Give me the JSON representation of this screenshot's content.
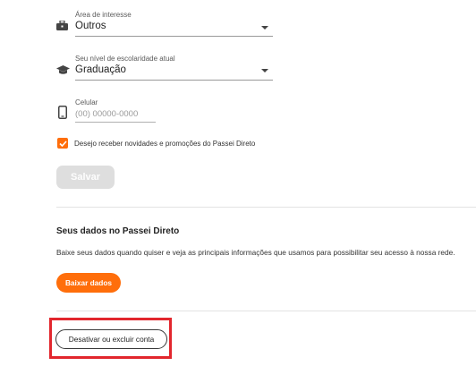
{
  "area": {
    "label": "Área de interesse",
    "value": "Outros"
  },
  "escolaridade": {
    "label": "Seu nível de escolaridade atual",
    "value": "Graduação"
  },
  "celular": {
    "label": "Celular",
    "placeholder": "(00) 00000-0000"
  },
  "newsletter": {
    "label": "Desejo receber novidades e promoções do Passei Direto",
    "checked": true
  },
  "save_label": "Salvar",
  "data_section": {
    "title": "Seus dados no Passei Direto",
    "description": "Baixe seus dados quando quiser e veja as principais informações que usamos para possibilitar seu acesso à nossa rede.",
    "download_label": "Baixar dados"
  },
  "deactivate_label": "Desativar ou excluir conta",
  "colors": {
    "accent": "#ff6e0b",
    "highlight": "#e2262d",
    "disabled": "#dedede"
  },
  "icons": [
    "briefcase-icon",
    "graduation-cap-icon",
    "phone-icon",
    "check-icon",
    "chevron-down-icon"
  ]
}
